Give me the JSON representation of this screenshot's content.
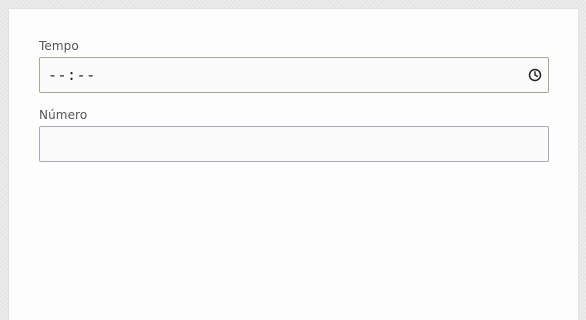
{
  "form": {
    "tempo": {
      "label": "Tempo",
      "value": "--:--",
      "icon": "clock-icon"
    },
    "numero": {
      "label": "Número",
      "value": ""
    }
  },
  "colors": {
    "card_background": "#fdfdfd",
    "time_field_border": "#a8a88e",
    "number_field_border": "#a9a8c9",
    "label_text": "#555555"
  }
}
